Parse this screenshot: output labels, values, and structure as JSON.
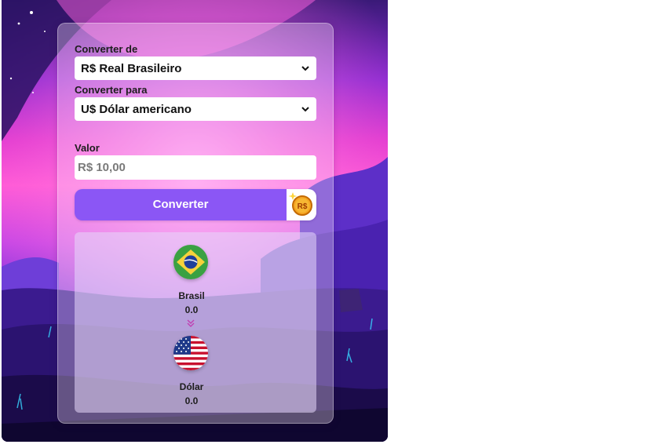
{
  "form": {
    "from_label": "Converter de",
    "from_value": "R$ Real Brasileiro",
    "to_label": "Converter para",
    "to_value": "U$ Dólar americano",
    "amount_label": "Valor",
    "amount_placeholder": "R$ 10,00",
    "convert_label": "Converter",
    "convert_icon": "real-coin-icon"
  },
  "result": {
    "from_flag": "brazil-flag-icon",
    "from_name": "Brasil",
    "from_value": "0.0",
    "arrow_icon": "double-chevron-down-icon",
    "to_flag": "usa-flag-icon",
    "to_name": "Dólar",
    "to_value": "0.0"
  },
  "colors": {
    "button": "#8b56f5",
    "background_accent": "#ff5ad6"
  }
}
